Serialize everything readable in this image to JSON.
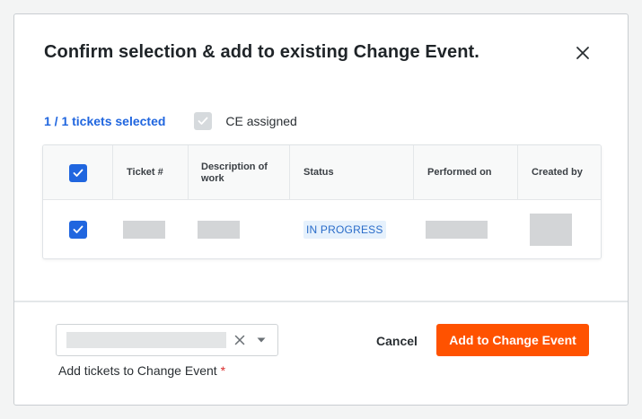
{
  "modal": {
    "title": "Confirm selection & add to existing Change Event."
  },
  "summary": {
    "selected_text": "1 / 1 tickets selected",
    "ce_assigned_label": "CE assigned",
    "ce_assigned_checked": true
  },
  "table": {
    "columns": [
      {
        "key": "select",
        "label": ""
      },
      {
        "key": "ticket",
        "label": "Ticket #"
      },
      {
        "key": "description",
        "label": "Description of work"
      },
      {
        "key": "status",
        "label": "Status"
      },
      {
        "key": "performed_on",
        "label": "Performed on"
      },
      {
        "key": "created_by",
        "label": "Created by"
      }
    ],
    "header_checkbox_checked": true,
    "rows": [
      {
        "checked": true,
        "ticket": "",
        "description": "",
        "status": "IN PROGRESS",
        "performed_on": "",
        "created_by": ""
      }
    ]
  },
  "footer": {
    "select_value": "",
    "select_label": "Add tickets to Change Event",
    "required_mark": "*",
    "cancel_label": "Cancel",
    "primary_label": "Add to Change Event"
  },
  "colors": {
    "accent": "#2066df",
    "primary_button": "#ff5200",
    "status_bg": "#e6f1fc",
    "status_text": "#2a6cc9",
    "required": "#d92b2b"
  },
  "icons": {
    "close": "close-icon",
    "check": "checkmark-icon",
    "clear": "clear-x-icon",
    "caret": "chevron-down-icon"
  }
}
